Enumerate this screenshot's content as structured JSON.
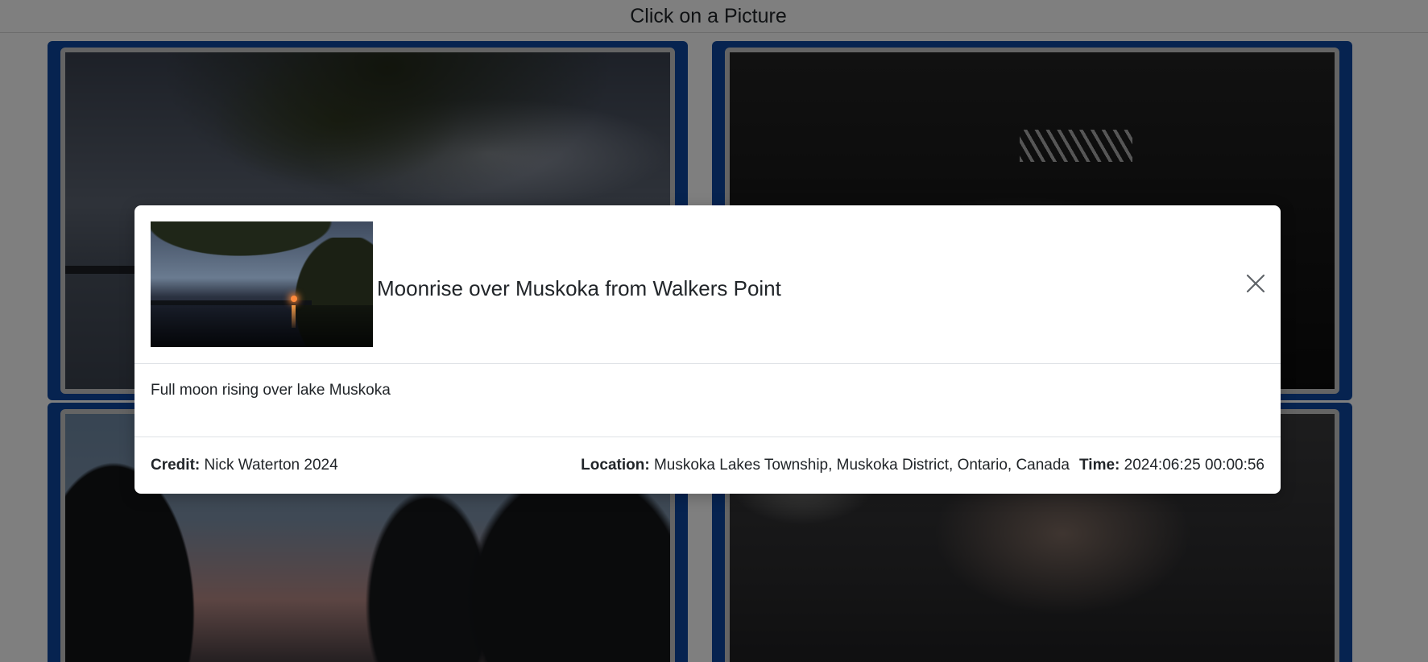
{
  "header": {
    "title": "Click on a Picture"
  },
  "modal": {
    "title": "Moonrise over Muskoka from Walkers Point",
    "description": "Full moon rising over lake Muskoka",
    "credit_label": "Credit:",
    "credit_value": "Nick Waterton 2024",
    "location_label": "Location:",
    "location_value": "Muskoka Lakes Township, Muskoka District, Ontario, Canada",
    "time_label": "Time:",
    "time_value": "2024:06:25 00:00:56",
    "close_icon": "close-icon"
  },
  "colors": {
    "tile_border": "#0d47a1",
    "overlay": "rgba(0,0,0,0.5)"
  }
}
